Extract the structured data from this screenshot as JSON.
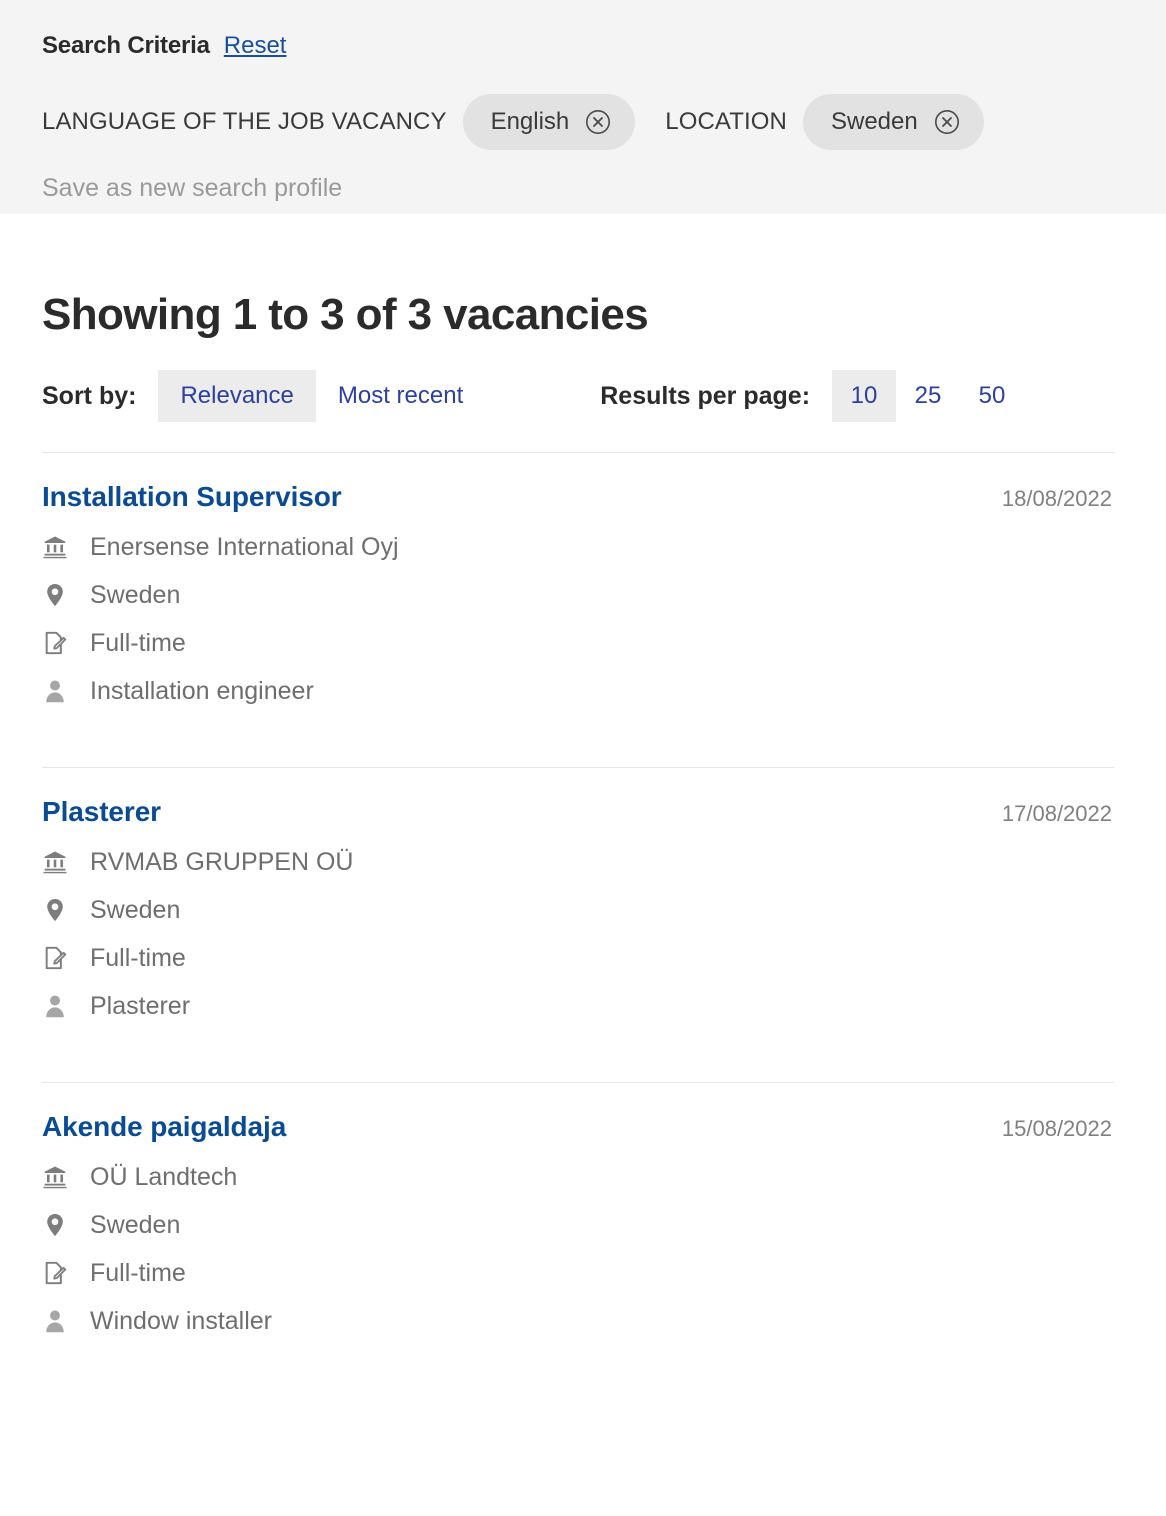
{
  "criteria": {
    "title": "Search Criteria",
    "reset_label": "Reset",
    "facets": [
      {
        "label": "LANGUAGE OF THE JOB VACANCY",
        "chip": "English",
        "remove_icon": "close-circle-icon"
      },
      {
        "label": "LOCATION",
        "chip": "Sweden",
        "remove_icon": "close-circle-icon"
      }
    ],
    "save_profile_label": "Save as new search profile"
  },
  "results": {
    "heading": "Showing 1 to 3 of 3 vacancies",
    "sort": {
      "label": "Sort by:",
      "options": [
        {
          "label": "Relevance",
          "selected": true
        },
        {
          "label": "Most recent",
          "selected": false
        }
      ]
    },
    "per_page": {
      "label": "Results per page:",
      "options": [
        {
          "label": "10",
          "selected": true
        },
        {
          "label": "25",
          "selected": false
        },
        {
          "label": "50",
          "selected": false
        }
      ]
    },
    "vacancies": [
      {
        "title": "Installation Supervisor",
        "date": "18/08/2022",
        "company": "Enersense International Oyj",
        "location": "Sweden",
        "contract": "Full-time",
        "occupation": "Installation engineer"
      },
      {
        "title": "Plasterer",
        "date": "17/08/2022",
        "company": "RVMAB GRUPPEN OÜ",
        "location": "Sweden",
        "contract": "Full-time",
        "occupation": "Plasterer"
      },
      {
        "title": "Akende paigaldaja",
        "date": "15/08/2022",
        "company": "OÜ Landtech",
        "location": "Sweden",
        "contract": "Full-time",
        "occupation": "Window installer"
      }
    ],
    "meta_icons": {
      "company": "bank-icon",
      "location": "map-pin-icon",
      "contract": "document-edit-icon",
      "occupation": "person-icon"
    }
  },
  "colors": {
    "band_background": "#f4f4f4",
    "chip_background": "#e2e2e2",
    "selected_option_background": "#ececec",
    "link_blue": "#2d3fa0",
    "title_blue": "#0a4b94",
    "reset_blue": "#1a4f9c",
    "muted_text": "#6e6e6e",
    "divider": "#e5e5e5"
  }
}
